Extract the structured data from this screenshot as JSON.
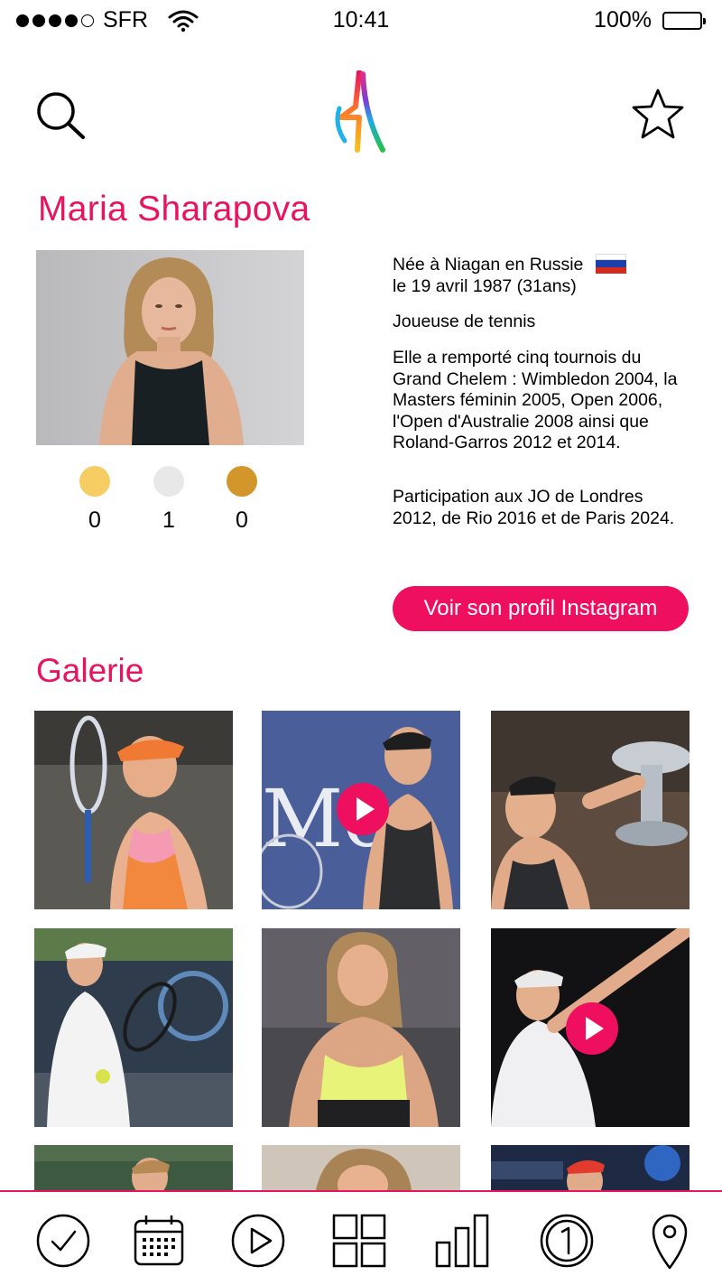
{
  "status_bar": {
    "carrier": "SFR",
    "time": "10:41",
    "battery": "100%"
  },
  "header": {
    "search_icon": "search-icon",
    "logo_icon": "paris-2024-logo",
    "favorite_icon": "star-icon"
  },
  "athlete": {
    "name": "Maria Sharapova",
    "birth_line1": "Née à Niagan en Russie",
    "birth_line2": "le 19 avril 1987 (31ans)",
    "sport": "Joueuse de tennis",
    "achievements": "Elle a remporté cinq tournois du Grand Chelem : Wimbledon 2004, la Masters féminin 2005, Open 2006, l'Open d'Australie 2008 ainsi que Roland-Garros 2012 et 2014.",
    "olympics": "Participation aux JO de Londres 2012, de Rio 2016 et de Paris 2024.",
    "flag_colors": [
      "#ffffff",
      "#1c3fa8",
      "#d52b1e"
    ]
  },
  "medals": [
    {
      "type": "gold",
      "color": "#f6cd63",
      "count": "0"
    },
    {
      "type": "silver",
      "color": "#e8e8e8",
      "count": "1"
    },
    {
      "type": "bronze",
      "color": "#d2962a",
      "count": "0"
    }
  ],
  "instagram_button": "Voir son profil Instagram",
  "gallery": {
    "title": "Galerie",
    "items": [
      {
        "kind": "photo"
      },
      {
        "kind": "video"
      },
      {
        "kind": "photo"
      },
      {
        "kind": "photo"
      },
      {
        "kind": "photo"
      },
      {
        "kind": "video"
      },
      {
        "kind": "photo"
      },
      {
        "kind": "photo"
      },
      {
        "kind": "photo"
      }
    ]
  },
  "tab_bar": [
    "check-circle-icon",
    "calendar-icon",
    "play-circle-icon",
    "grid-icon",
    "bar-chart-icon",
    "number-one-circle-icon",
    "map-pin-icon"
  ],
  "colors": {
    "accent": "#e8145f",
    "button": "#ee0f5f"
  }
}
